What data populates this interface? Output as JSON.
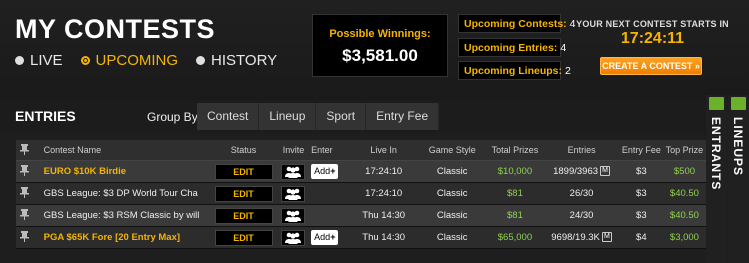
{
  "header": {
    "title": "MY CONTESTS",
    "tabs": [
      {
        "label": "LIVE",
        "active": false
      },
      {
        "label": "UPCOMING",
        "active": true
      },
      {
        "label": "HISTORY",
        "active": false
      }
    ]
  },
  "winnings": {
    "label": "Possible Winnings:",
    "value": "$3,581.00"
  },
  "stats": [
    {
      "label": "Upcoming Contests:",
      "value": "4"
    },
    {
      "label": "Upcoming Entries:",
      "value": "4"
    },
    {
      "label": "Upcoming Lineups:",
      "value": "2"
    }
  ],
  "next_contest": {
    "label": "YOUR NEXT CONTEST STARTS IN",
    "time": "17:24:11"
  },
  "create_button": "CREATE A CONTEST »",
  "entries": {
    "title": "ENTRIES",
    "group_by_label": "Group By:",
    "group_by": [
      "Contest",
      "Lineup",
      "Sport",
      "Entry Fee"
    ]
  },
  "table": {
    "headers": {
      "name": "Contest Name",
      "status": "Status",
      "invite": "Invite",
      "enter": "Enter",
      "live": "Live In",
      "style": "Game Style",
      "prizes": "Total Prizes",
      "entries": "Entries",
      "fee": "Entry Fee",
      "top": "Top Prize"
    },
    "rows": [
      {
        "name": "EURO $10K Birdie",
        "highlight": true,
        "status": "EDIT",
        "add": "Add",
        "live": "17:24:10",
        "style": "Classic",
        "prizes": "$10,000",
        "entries": "1899/3963",
        "badge": "M",
        "fee": "$3",
        "top": "$500"
      },
      {
        "name": "GBS League: $3 DP World Tour Cha",
        "highlight": false,
        "status": "EDIT",
        "add": "",
        "live": "17:24:10",
        "style": "Classic",
        "prizes": "$81",
        "entries": "26/30",
        "badge": "",
        "fee": "$3",
        "top": "$40.50"
      },
      {
        "name": "GBS League: $3 RSM Classic by will",
        "highlight": false,
        "status": "EDIT",
        "add": "",
        "live": "Thu 14:30",
        "style": "Classic",
        "prizes": "$81",
        "entries": "24/30",
        "badge": "",
        "fee": "$3",
        "top": "$40.50"
      },
      {
        "name": "PGA $65K Fore [20 Entry Max]",
        "highlight": true,
        "status": "EDIT",
        "add": "Add",
        "live": "Thu 14:30",
        "style": "Classic",
        "prizes": "$65,000",
        "entries": "9698/19.3K",
        "badge": "M",
        "fee": "$4",
        "top": "$3,000"
      }
    ]
  },
  "side_tabs": [
    "ENTRANTS",
    "LINEUPS"
  ],
  "colors": {
    "accent": "#f5b400",
    "money": "#8fd14f",
    "button": "#f07d00",
    "tab_icon": "#6bb12a"
  }
}
